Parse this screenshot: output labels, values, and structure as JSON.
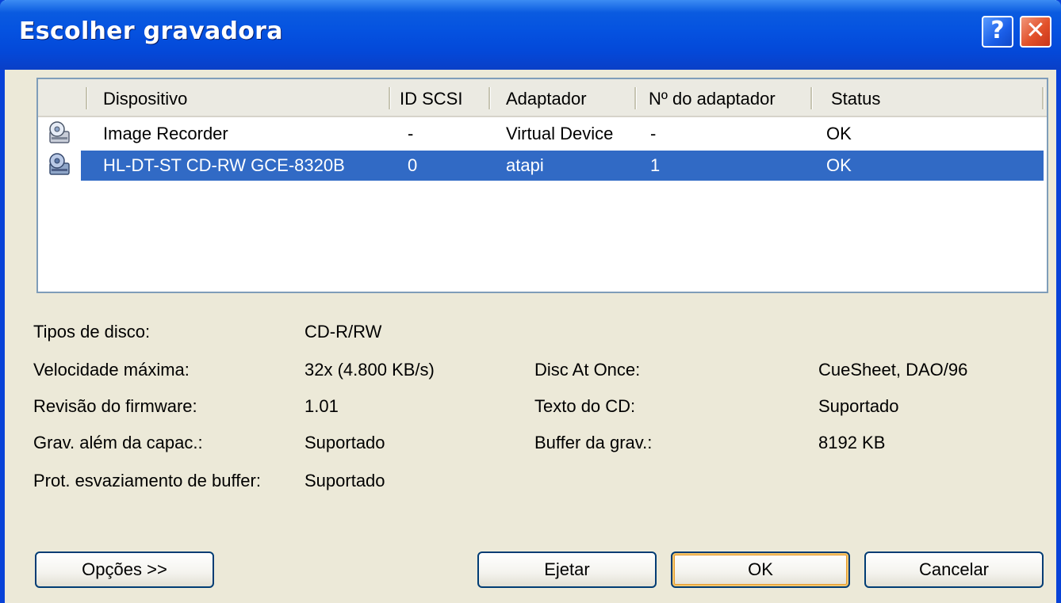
{
  "window": {
    "title": "Escolher gravadora"
  },
  "titlebar": {
    "help_label": "?",
    "close_label": "✕"
  },
  "list": {
    "columns": [
      "Dispositivo",
      "ID SCSI",
      "Adaptador",
      "Nº do adaptador",
      "Status"
    ],
    "rows": [
      {
        "icon": "drive-icon",
        "device": "Image Recorder",
        "scsi_id": "-",
        "adapter": "Virtual Device",
        "adapter_no": "-",
        "status": "OK",
        "selected": false
      },
      {
        "icon": "drive-icon",
        "device": "HL-DT-ST CD-RW GCE-8320B",
        "scsi_id": "0",
        "adapter": "atapi",
        "adapter_no": "1",
        "status": "OK",
        "selected": true
      }
    ]
  },
  "properties": {
    "disc_types_label": "Tipos de disco:",
    "disc_types_value": "CD-R/RW",
    "max_speed_label": "Velocidade máxima:",
    "max_speed_value": "32x (4.800 KB/s)",
    "firmware_label": "Revisão do firmware:",
    "firmware_value": "1.01",
    "overburn_label": "Grav. além da capac.:",
    "overburn_value": "Suportado",
    "buffer_protect_label": "Prot. esvaziamento de buffer:",
    "buffer_protect_value": "Suportado",
    "dao_label": "Disc At Once:",
    "dao_value": "CueSheet, DAO/96",
    "cdtext_label": "Texto do CD:",
    "cdtext_value": "Suportado",
    "buffer_label": "Buffer da grav.:",
    "buffer_value": "8192 KB"
  },
  "buttons": {
    "options": "Opções >>",
    "eject": "Ejetar",
    "ok": "OK",
    "cancel": "Cancelar"
  },
  "colors": {
    "selection": "#316AC5",
    "titlebar": "#0552E0",
    "dialog_bg": "#ECE9D8"
  }
}
